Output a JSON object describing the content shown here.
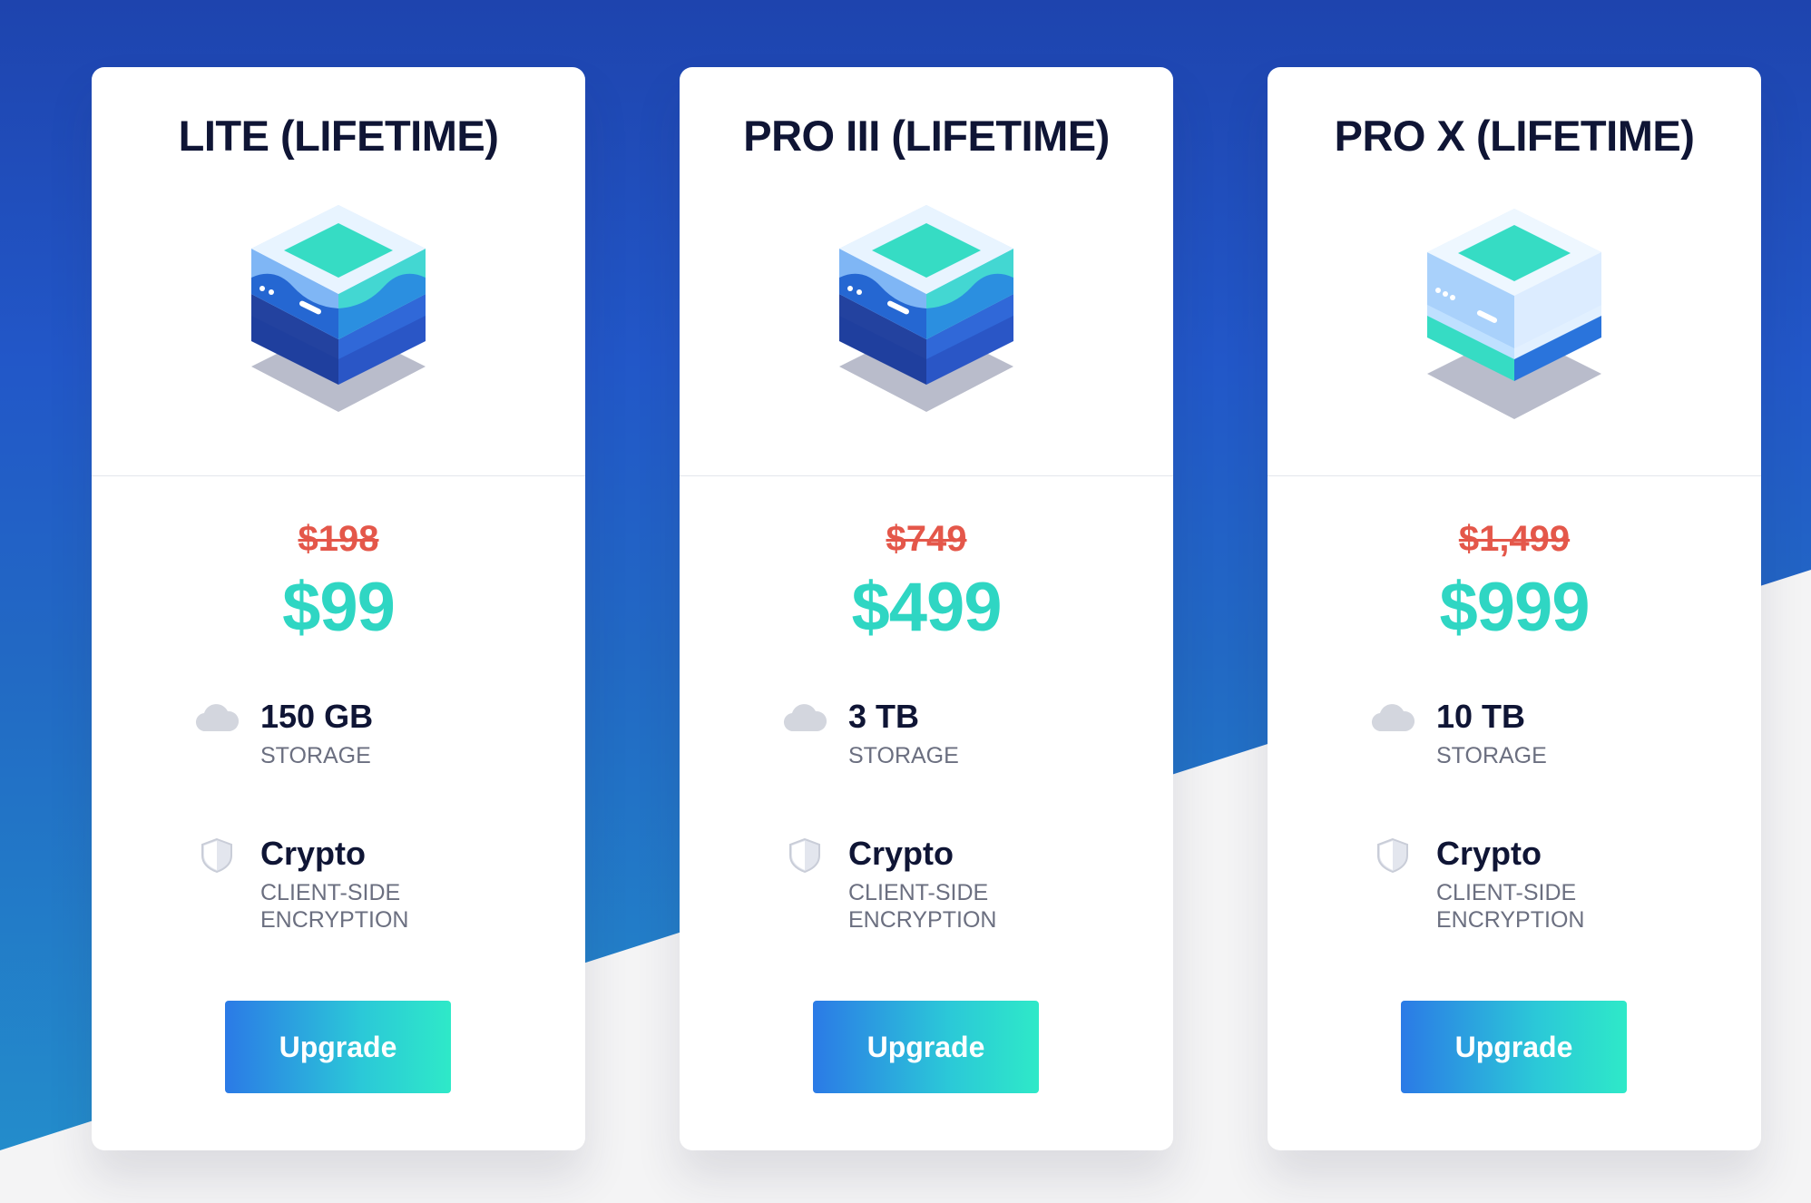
{
  "colors": {
    "background_blue": "#2257c8",
    "title": "#0f1535",
    "old_price": "#e4574a",
    "new_price": "#2fd6c3",
    "button_start": "#2b7ae6",
    "button_end": "#2ee9c8"
  },
  "plans": [
    {
      "title": "LITE (LIFETIME)",
      "icon": "storage-box-icon",
      "old_price": "$198",
      "price": "$99",
      "storage": {
        "icon": "cloud-icon",
        "value": "150 GB",
        "label": "STORAGE"
      },
      "crypto": {
        "icon": "shield-icon",
        "value": "Crypto",
        "label_line1": "CLIENT-SIDE",
        "label_line2": "ENCRYPTION"
      },
      "button": "Upgrade"
    },
    {
      "title": "PRO III (LIFETIME)",
      "icon": "storage-box-icon",
      "old_price": "$749",
      "price": "$499",
      "storage": {
        "icon": "cloud-icon",
        "value": "3 TB",
        "label": "STORAGE"
      },
      "crypto": {
        "icon": "shield-icon",
        "value": "Crypto",
        "label_line1": "CLIENT-SIDE",
        "label_line2": "ENCRYPTION"
      },
      "button": "Upgrade"
    },
    {
      "title": "PRO X (LIFETIME)",
      "icon": "server-box-icon",
      "old_price": "$1,499",
      "price": "$999",
      "storage": {
        "icon": "cloud-icon",
        "value": "10 TB",
        "label": "STORAGE"
      },
      "crypto": {
        "icon": "shield-icon",
        "value": "Crypto",
        "label_line1": "CLIENT-SIDE",
        "label_line2": "ENCRYPTION"
      },
      "button": "Upgrade"
    }
  ]
}
